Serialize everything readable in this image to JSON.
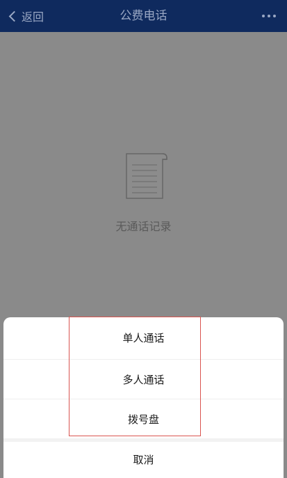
{
  "navbar": {
    "back_label": "返回",
    "title": "公费电话"
  },
  "content": {
    "empty_text": "无通话记录"
  },
  "action_sheet": {
    "items": [
      {
        "label": "单人通话"
      },
      {
        "label": "多人通话"
      },
      {
        "label": "拨号盘"
      }
    ],
    "cancel_label": "取消"
  },
  "colors": {
    "navbar_bg": "#0f2a5e",
    "overlay_bg": "#8a8a8a",
    "highlight": "#d9534f"
  },
  "icons": {
    "back": "chevron-left-icon",
    "more": "more-dots-icon",
    "empty": "document-icon"
  }
}
